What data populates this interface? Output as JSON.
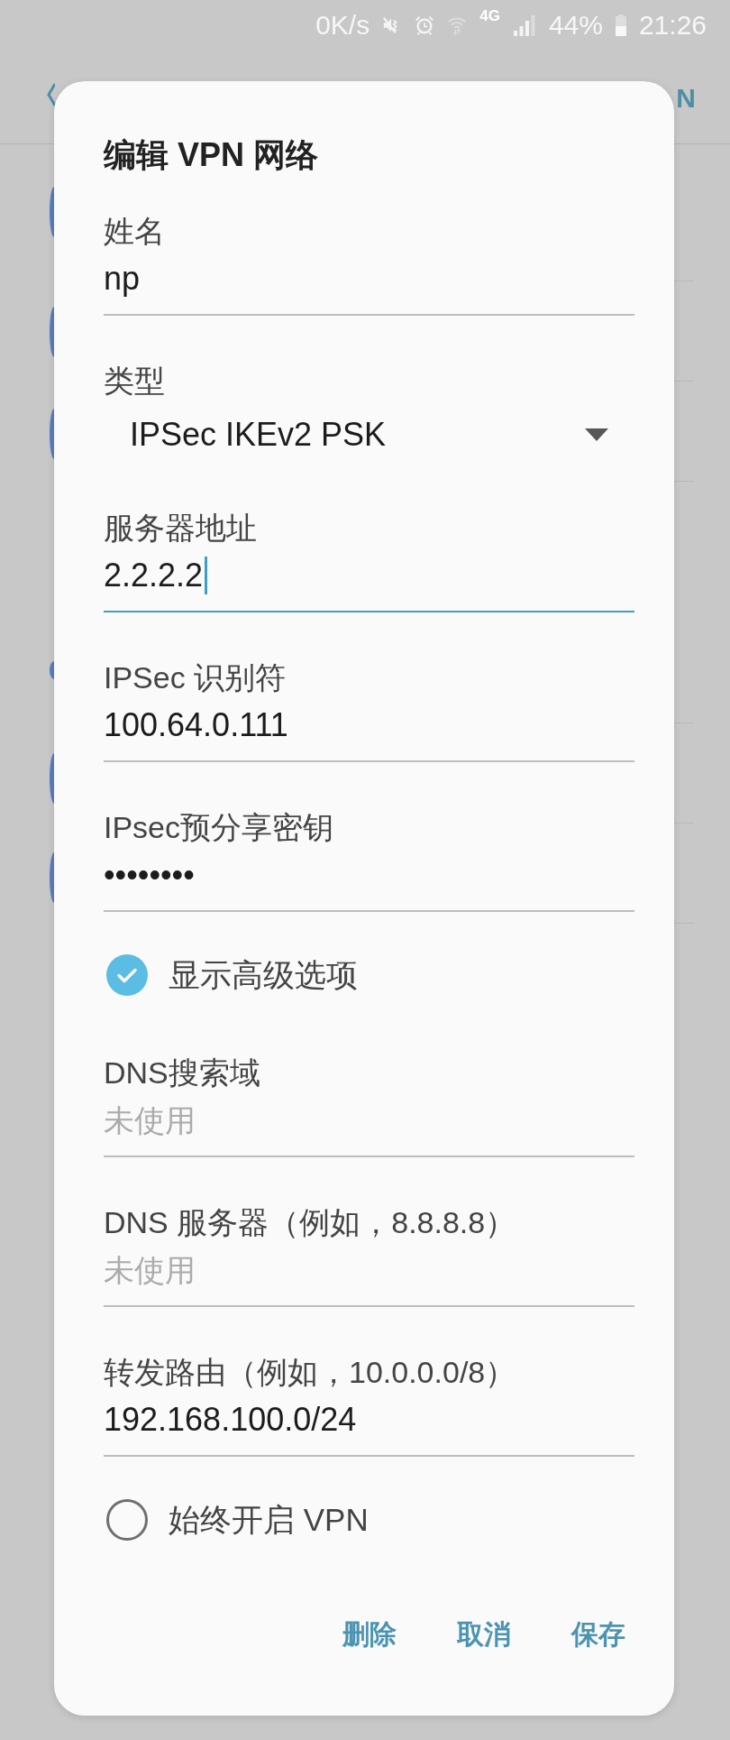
{
  "status_bar": {
    "speed": "0K/s",
    "network": "4G",
    "battery": "44%",
    "time": "21:26"
  },
  "background": {
    "app_bar_text": "N"
  },
  "dialog": {
    "title": "编辑 VPN 网络",
    "items": [
      {
        "kind": "text",
        "label": "姓名",
        "value": "np",
        "focused": false
      },
      {
        "kind": "dropdown",
        "label": "类型",
        "value": "IPSec IKEv2 PSK"
      },
      {
        "kind": "text",
        "label": "服务器地址",
        "value": "2.2.2.2",
        "focused": true
      },
      {
        "kind": "text",
        "label": "IPSec 识别符",
        "value": "100.64.0.111",
        "focused": false
      },
      {
        "kind": "text",
        "label": "IPsec预分享密钥",
        "value": "••••••••",
        "focused": false
      },
      {
        "kind": "checkbox",
        "label": "显示高级选项",
        "checked": true
      },
      {
        "kind": "text",
        "label": "DNS搜索域",
        "placeholder": "未使用",
        "focused": false
      },
      {
        "kind": "text",
        "label": "DNS 服务器（例如，8.8.8.8）",
        "placeholder": "未使用",
        "focused": false
      },
      {
        "kind": "text",
        "label": "转发路由（例如，10.0.0.0/8）",
        "value": "192.168.100.0/24",
        "focused": false
      },
      {
        "kind": "checkbox",
        "label": "始终开启 VPN",
        "checked": false
      }
    ],
    "buttons": [
      "删除",
      "取消",
      "保存"
    ]
  }
}
